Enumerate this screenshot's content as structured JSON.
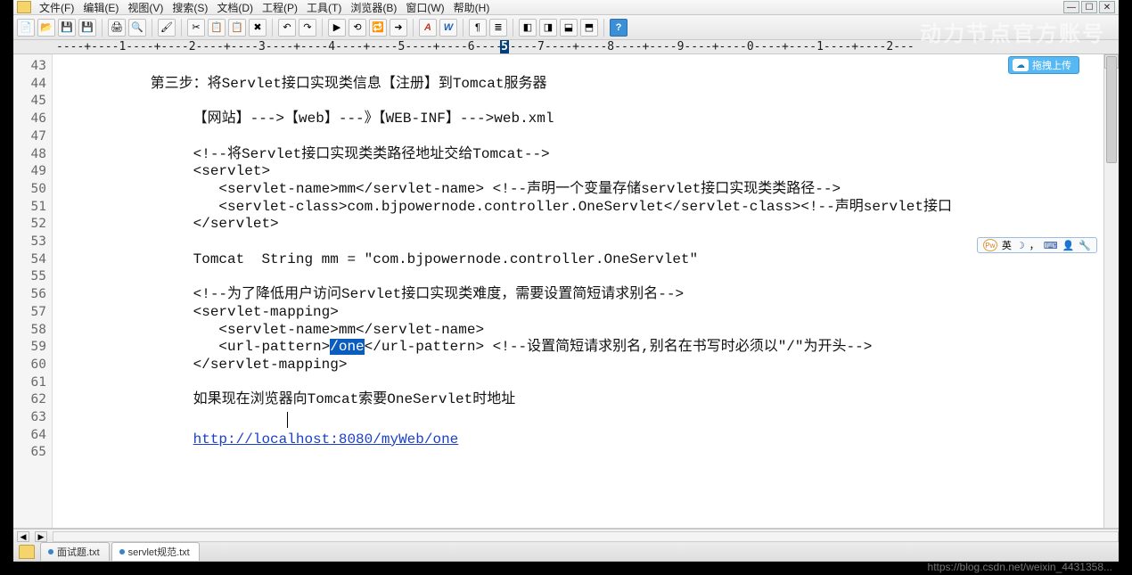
{
  "watermark": "动力节点官方账号",
  "footnote": "https://blog.csdn.net/weixin_4431358...",
  "menu": {
    "items": [
      {
        "label": "文件(F)"
      },
      {
        "label": "编辑(E)"
      },
      {
        "label": "视图(V)"
      },
      {
        "label": "搜索(S)"
      },
      {
        "label": "文档(D)"
      },
      {
        "label": "工程(P)"
      },
      {
        "label": "工具(T)"
      },
      {
        "label": "浏览器(B)"
      },
      {
        "label": "窗口(W)"
      },
      {
        "label": "帮助(H)"
      }
    ]
  },
  "toolbar": {
    "groups": [
      [
        "new-file",
        "open-file",
        "save",
        "save-all"
      ],
      [
        "print",
        "print-preview"
      ],
      [
        "copy-format"
      ],
      [
        "cut",
        "copy",
        "paste",
        "delete"
      ],
      [
        "undo",
        "redo"
      ],
      [
        "record-macro",
        "play-macro",
        "replace",
        "goto"
      ],
      [
        "font-color",
        "word-wrap"
      ],
      [
        "show-invisible",
        "indent-guides"
      ],
      [
        "panel-left",
        "panel-right",
        "panel-bottom",
        "panel-top"
      ],
      [
        "help"
      ]
    ]
  },
  "ruler": {
    "marker": "5",
    "text": "----+----1----+----2----+----3----+----4----+----5----+----6----+----7----+----8----+----9----+----0----+----1----+----2---"
  },
  "upload": {
    "label": "拖拽上传"
  },
  "ime": {
    "lang": "英"
  },
  "tabs": [
    {
      "label": "面试题.txt",
      "active": false
    },
    {
      "label": "servlet规范.txt",
      "active": true
    }
  ],
  "editor": {
    "first_line": 43,
    "selected": "/one",
    "url": "http://localhost:8080/myWeb/one",
    "lines": [
      "",
      "           第三步：将Servlet接口实现类信息【注册】到Tomcat服务器",
      "",
      "                【网站】--->【web】---》【WEB-INF】--->web.xml",
      "",
      "                <!--将Servlet接口实现类类路径地址交给Tomcat-->",
      "                <servlet>",
      "                   <servlet-name>mm</servlet-name> <!--声明一个变量存储servlet接口实现类类路径-->",
      "                   <servlet-class>com.bjpowernode.controller.OneServlet</servlet-class><!--声明servlet接口",
      "                </servlet>",
      "",
      "                Tomcat  String mm = \"com.bjpowernode.controller.OneServlet\"",
      "",
      "                <!--为了降低用户访问Servlet接口实现类难度，需要设置简短请求别名-->",
      "                <servlet-mapping>",
      "                   <servlet-name>mm</servlet-name>",
      "                   <url-pattern>{{SEL}}</url-pattern> <!--设置简短请求别名,别名在书写时必须以\"/\"为开头-->",
      "                </servlet-mapping>",
      "",
      "                如果现在浏览器向Tomcat索要OneServlet时地址",
      "                           {{CARET}}",
      "                {{URL}}",
      ""
    ]
  }
}
